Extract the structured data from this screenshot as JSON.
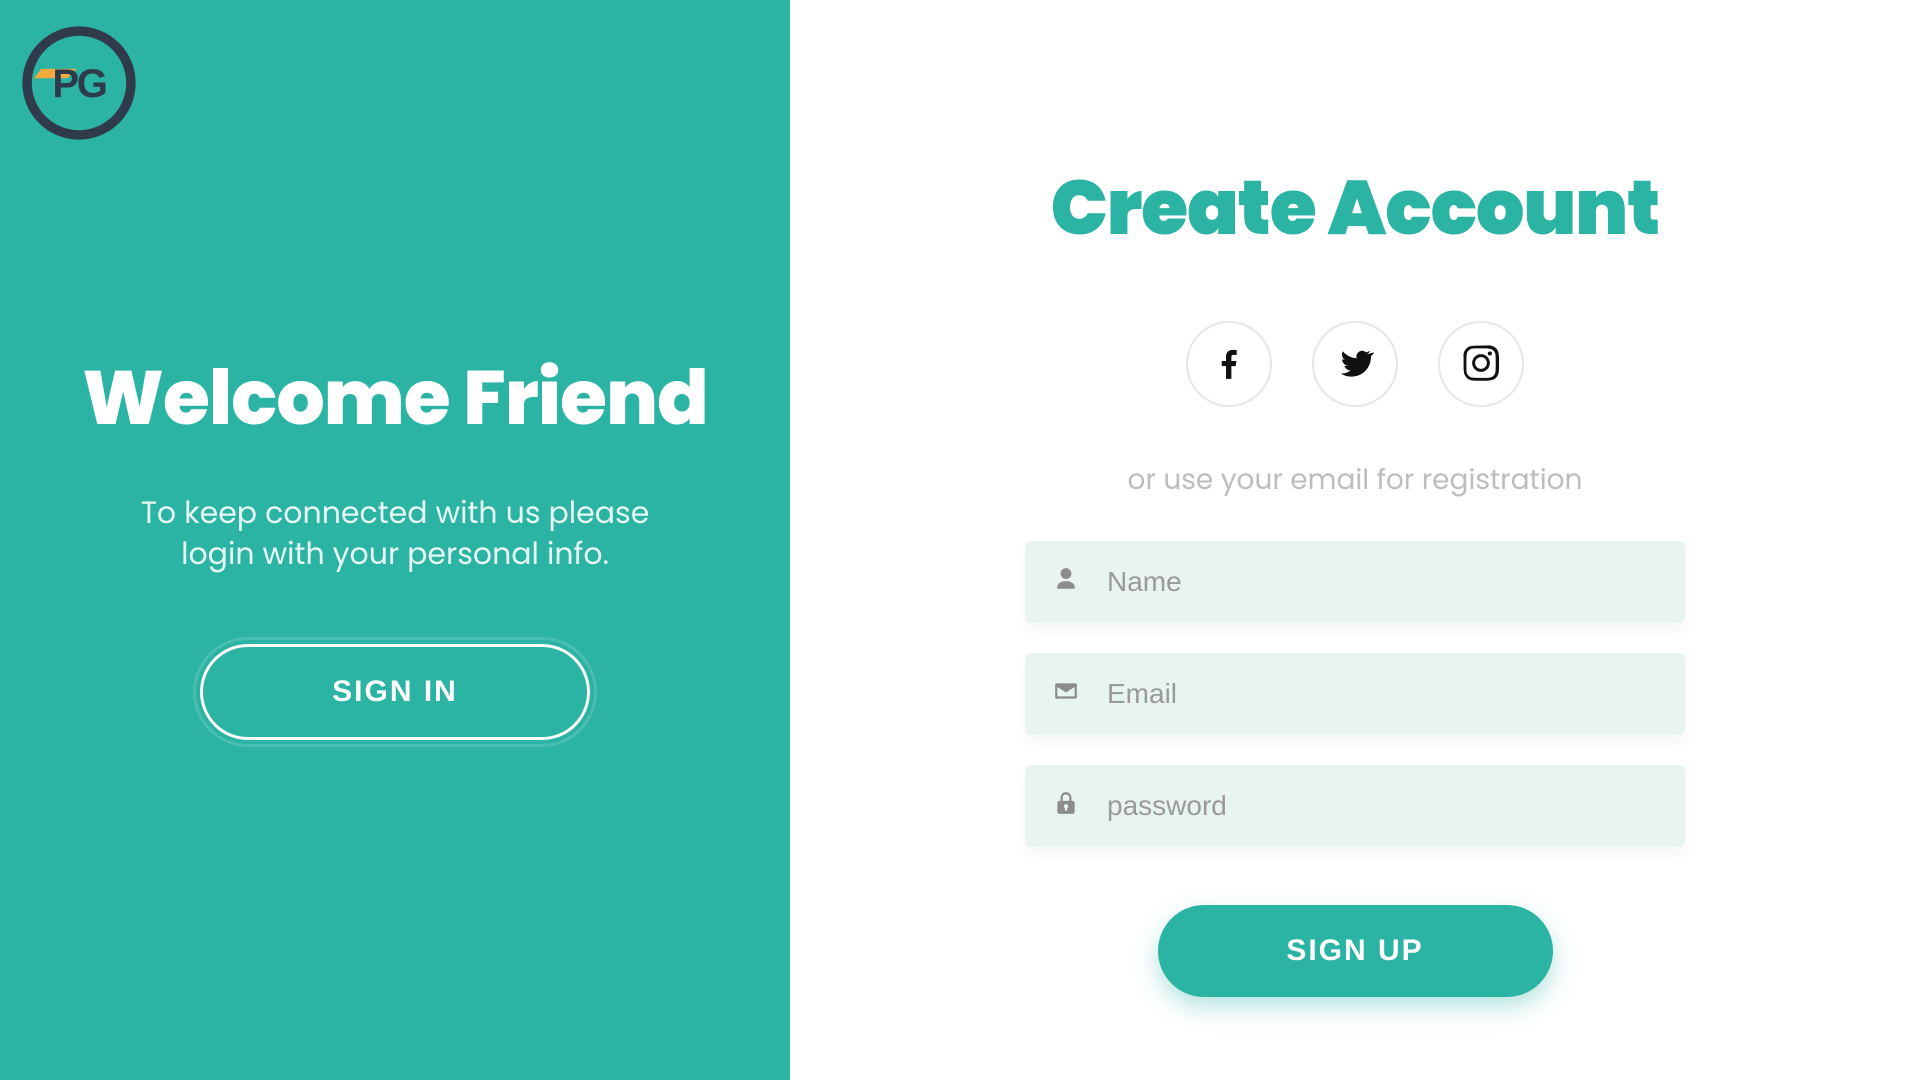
{
  "colors": {
    "accent": "#2bb3a3",
    "fieldBg": "#e7f4ef",
    "muted": "#bdbdbd"
  },
  "left": {
    "title": "Welcome Friend",
    "subtitle": "To keep connected with us please login with your personal info.",
    "signin_label": "SIGN IN"
  },
  "right": {
    "title": "Create Account",
    "or_line": "or use your email for registration",
    "social": [
      "facebook",
      "twitter",
      "instagram"
    ],
    "fields": {
      "name": {
        "placeholder": "Name",
        "value": "",
        "icon": "user"
      },
      "email": {
        "placeholder": "Email",
        "value": "",
        "icon": "envelope"
      },
      "password": {
        "placeholder": "password",
        "value": "",
        "icon": "lock"
      }
    },
    "signup_label": "SIGN UP"
  },
  "logo": {
    "text": "PG"
  }
}
